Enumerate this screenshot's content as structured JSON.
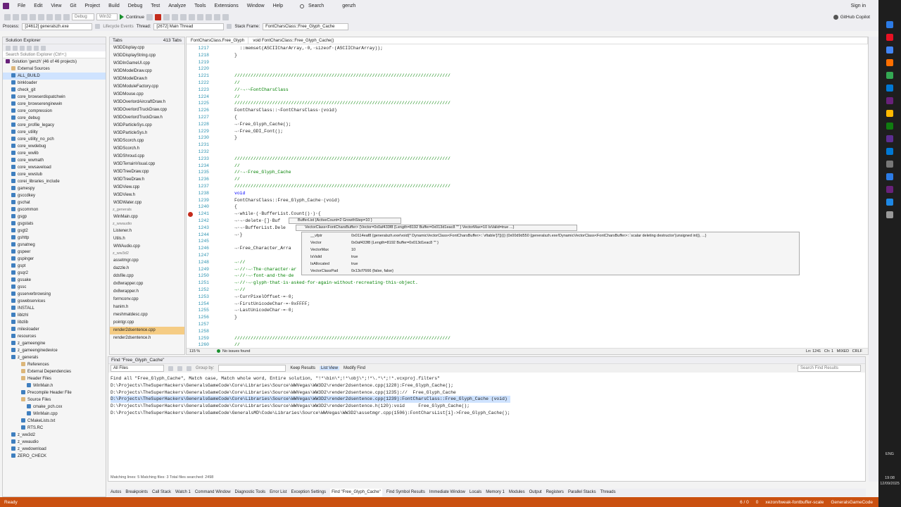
{
  "menu": [
    "File",
    "Edit",
    "View",
    "Git",
    "Project",
    "Build",
    "Debug",
    "Test",
    "Analyze",
    "Tools",
    "Extensions",
    "Window",
    "Help"
  ],
  "search_label": "Search",
  "solution_name": "genzh",
  "sign_in": "Sign in",
  "copilot": "GitHub Copilot",
  "toolbar": {
    "config": "Debug",
    "platform": "Win32",
    "continue": "Continue"
  },
  "procbar": {
    "process_label": "Process:",
    "process": "[24612] generalszh.exe",
    "lifecycle": "Lifecycle Events",
    "thread_label": "Thread:",
    "thread": "[2672] Main Thread",
    "frame_label": "Stack Frame:",
    "frame": "FontCharsClass::Free_Glyph_Cache"
  },
  "solution_explorer": {
    "title": "Solution Explorer",
    "search": "Search Solution Explorer (Ctrl+;)",
    "items": [
      "Solution 'genzh' (46 of 46 projects)",
      "External Sources",
      "ALL_BUILD",
      "binkloader",
      "check_git",
      "core_browserdispatchwin",
      "core_browserenginewin",
      "core_compression",
      "core_debug",
      "core_profile_legacy",
      "core_utility",
      "core_utility_no_pch",
      "core_wwdebug",
      "core_wwlib",
      "core_wwmath",
      "core_wwsaveload",
      "core_wwstub",
      "corei_libraries_include",
      "gamespy",
      "gsccdkey",
      "gschat",
      "gscommon",
      "gsgp",
      "gsgstats",
      "gsgt2",
      "gshttp",
      "gsnatneg",
      "gspeer",
      "gspinger",
      "gspt",
      "gsqr2",
      "gssake",
      "gssc",
      "gsserverbrowsing",
      "gswebservices",
      "INSTALL",
      "liblzhl",
      "libzlib",
      "milesloader",
      "resources",
      "z_gameengine",
      "z_gameenginedevice",
      "z_generals",
      "References",
      "External Dependencies",
      "Header Files",
      "WinMain.h",
      "Precompile Header File",
      "Source Files",
      "cmake_pch.cxx",
      "WinMain.cpp",
      "CMakeLists.txt",
      "RTS.RC",
      "z_ww3d2",
      "z_wwaudio",
      "z_wwdownload",
      "ZERO_CHECK"
    ]
  },
  "tabs_panel": {
    "title": "Tabs",
    "count": "413 Tabs",
    "groups": [
      {
        "name": "",
        "items": [
          "W3DDisplay.cpp",
          "W3DDisplayString.cpp",
          "W3DInGameUI.cpp",
          "W3DModelDraw.cpp",
          "W3DModelDraw.h",
          "W3DModuleFactory.cpp",
          "W3DMouse.cpp",
          "W3DOverlordAircraftDraw.h",
          "W3DOverlordTruckDraw.cpp",
          "W3DOverlordTruckDraw.h",
          "W3DParticleSys.cpp",
          "W3DParticleSys.h",
          "W3DScorch.cpp",
          "W3DScorch.h",
          "W3DShroud.cpp",
          "W3DTerrainVisual.cpp",
          "W3DTreeDraw.cpp",
          "W3DTreeDraw.h",
          "W3DView.cpp",
          "W3DView.h",
          "W3DWater.cpp"
        ]
      },
      {
        "name": "z_generals",
        "items": [
          "WinMain.cpp"
        ]
      },
      {
        "name": "z_wwaudio",
        "items": [
          "Listener.h",
          "Utils.h",
          "WWAudio.cpp"
        ]
      },
      {
        "name": "z_ww3d2",
        "items": [
          "assetmgr.cpp",
          "dazzle.h",
          "ddsfile.cpp",
          "dx8wrapper.cpp",
          "dx8wrapper.h",
          "formconv.cpp",
          "hanim.h",
          "meshmatdesc.cpp",
          "pointgr.cpp",
          "render2dsentence.cpp",
          "render2dsentence.h"
        ]
      }
    ]
  },
  "editor": {
    "file_tab": "FontCharsClass.Free_Glyph",
    "member": "void FontCharsClass::Free_Glyph_Cache()",
    "lines": [
      {
        "n": "1217",
        "t": "  ::memset(ASCIICharArray,·0,·sizeof·(ASCIICharArray));",
        "k": "c"
      },
      {
        "n": "1218",
        "t": "}",
        "k": "c"
      },
      {
        "n": "1219",
        "t": "",
        "k": "c"
      },
      {
        "n": "1220",
        "t": "",
        "k": "c"
      },
      {
        "n": "1221",
        "t": "////////////////////////////////////////////////////////////////////////////////",
        "k": "m"
      },
      {
        "n": "1222",
        "t": "//",
        "k": "m"
      },
      {
        "n": "1223",
        "t": "//·→·~FontCharsClass",
        "k": "m"
      },
      {
        "n": "1224",
        "t": "//",
        "k": "m"
      },
      {
        "n": "1225",
        "t": "////////////////////////////////////////////////////////////////////////////////",
        "k": "m"
      },
      {
        "n": "1226",
        "t": "FontCharsClass::~FontCharsClass·(void)",
        "k": "c"
      },
      {
        "n": "1227",
        "t": "{",
        "k": "c"
      },
      {
        "n": "1228",
        "t": "→·Free_Glyph_Cache();",
        "k": "c"
      },
      {
        "n": "1229",
        "t": "→·Free_GDI_Font();",
        "k": "c"
      },
      {
        "n": "1230",
        "t": "}",
        "k": "c"
      },
      {
        "n": "1231",
        "t": "",
        "k": "c"
      },
      {
        "n": "1232",
        "t": "",
        "k": "c"
      },
      {
        "n": "1233",
        "t": "////////////////////////////////////////////////////////////////////////////////",
        "k": "m"
      },
      {
        "n": "1234",
        "t": "//",
        "k": "m"
      },
      {
        "n": "1235",
        "t": "//·→·Free_Glyph_Cache",
        "k": "m"
      },
      {
        "n": "1236",
        "t": "//",
        "k": "m"
      },
      {
        "n": "1237",
        "t": "////////////////////////////////////////////////////////////////////////////////",
        "k": "m"
      },
      {
        "n": "1238",
        "t": "void",
        "k": "k"
      },
      {
        "n": "1239",
        "t": "FontCharsClass::Free_Glyph_Cache·(void)",
        "k": "c"
      },
      {
        "n": "1240",
        "t": "{",
        "k": "c"
      },
      {
        "n": "1241",
        "t": "→·while·(·BufferList.Count()·)·{",
        "k": "c"
      },
      {
        "n": "1242",
        "t": "→·→·delete·[]·Buf",
        "k": "c"
      },
      {
        "n": "1243",
        "t": "→·→·BufferList.Dele",
        "k": "c"
      },
      {
        "n": "1244",
        "t": "→·}",
        "k": "c"
      },
      {
        "n": "1245",
        "t": "",
        "k": "c"
      },
      {
        "n": "1246",
        "t": "→·Free_Character_Arra",
        "k": "c"
      },
      {
        "n": "1247",
        "t": "",
        "k": "c"
      },
      {
        "n": "1248",
        "t": "→·//",
        "k": "m"
      },
      {
        "n": "1249",
        "t": "→·//·→·The·character·ar",
        "k": "m"
      },
      {
        "n": "1250",
        "t": "→·//·→·font·and·the·de",
        "k": "m"
      },
      {
        "n": "1251",
        "t": "→·//·→·glyph·that·is·asked·for·again·without·recreating·this·object.",
        "k": "m"
      },
      {
        "n": "1252",
        "t": "→·//",
        "k": "m"
      },
      {
        "n": "1253",
        "t": "→·CurrPixelOffset·=·0;",
        "k": "c"
      },
      {
        "n": "1254",
        "t": "→·FirstUnicodeChar·=·0xFFFF;",
        "k": "c"
      },
      {
        "n": "1255",
        "t": "→·LastUnicodeChar·=·0;",
        "k": "c"
      },
      {
        "n": "1256",
        "t": "}",
        "k": "c"
      },
      {
        "n": "1257",
        "t": "",
        "k": "c"
      },
      {
        "n": "1258",
        "t": "",
        "k": "c"
      },
      {
        "n": "1259",
        "t": "////////////////////////////////////////////////////////////////////////////////",
        "k": "m"
      },
      {
        "n": "1260",
        "t": "//",
        "k": "m"
      }
    ],
    "zoom": "115 %",
    "issues": "No issues found",
    "position": "Ln: 1241   Ch: 1   MIXED   CRLF"
  },
  "datatip": {
    "root": "BufferList {ActiveCount=2 GrowthStep=10 }",
    "vector": "VectorClass<FontCharsBuffer> {Vector=0x0af433f8 {Length=8192 Buffer=0x013d1eac8 \"\" } VectorMax=10 IsValid=true ...}",
    "rows": [
      {
        "name": "__vfptr",
        "value": "0x0114eaf8 {generalszh.exe!void(* DynamicVectorClass<FontCharsBuffer>::`vftable'[7])()} {0x00d9d550 {generalszh.exe!DynamicVectorClass<FontCharsBuffer>::`scalar deleting destructor'(unsigned int)}, ...}"
      },
      {
        "name": "Vector",
        "value": "0x0af433f8 {Length=8192 Buffer=0x013d1eac8 \"\" }"
      },
      {
        "name": "VectorMax",
        "value": "10"
      },
      {
        "name": "IsValid",
        "value": "true"
      },
      {
        "name": "IsAllocated",
        "value": "true"
      },
      {
        "name": "VectorClassPad",
        "value": "0x13cf7666 {false, false}"
      }
    ]
  },
  "find": {
    "title": "Find \"Free_Glyph_Cache\"",
    "scope": "All Files",
    "group_by": "Group by:",
    "keep": "Keep Results",
    "list": "List View",
    "modify": "Modify Find",
    "search": "Search Find Results",
    "lines": [
      "Find all \"Free_Glyph_Cache\", Match case, Match whole word, Entire solution, \"!*\\bin\\*;!*\\obj\\*;!*\\.*\\*;!*.vcxproj.filters\"",
      "D:\\Projects\\TheSuperHackers\\GeneralsGameCode\\Core\\Libraries\\Source\\WWVegas\\WW3D2\\render2dsentence.cpp(1228):Free_Glyph_Cache();",
      "D:\\Projects\\TheSuperHackers\\GeneralsGameCode\\Core\\Libraries\\Source\\WWVegas\\WW3D2\\render2dsentence.cpp(1235)://  Free_Glyph_Cache",
      "D:\\Projects\\TheSuperHackers\\GeneralsGameCode\\Core\\Libraries\\Source\\WWVegas\\WW3D2\\render2dsentence.cpp(1239):FontCharsClass::Free_Glyph_Cache (void)",
      "D:\\Projects\\TheSuperHackers\\GeneralsGameCode\\Core\\Libraries\\Source\\WWVegas\\WW3D2\\render2dsentence.h(120):void     Free_Glyph_Cache();",
      "D:\\Projects\\TheSuperHackers\\GeneralsGameCode\\GeneralsMD\\Code\\Libraries\\Source\\WWVegas\\WW3D2\\assetmgr.cpp(1506):FontCharsList[i]->Free_Glyph_Cache();"
    ],
    "footer": "Matching lines: 5 Matching files: 3 Total files searched: 2498"
  },
  "bottom_tabs": [
    "Autos",
    "Breakpoints",
    "Call Stack",
    "Watch 1",
    "Command Window",
    "Diagnostic Tools",
    "Error List",
    "Exception Settings",
    "Find \"Free_Glyph_Cache\"",
    "Find Symbol Results",
    "Immediate Window",
    "Locals",
    "Memory 1",
    "Modules",
    "Output",
    "Registers",
    "Parallel Stacks",
    "Threads"
  ],
  "status": {
    "ready": "Ready",
    "arrows": "6 / 0",
    "pencil": "0",
    "branch": "xezon/tweak-fontbuffer-scale",
    "repo": "GeneralsGameCode"
  },
  "clock": {
    "time": "19:08",
    "date": "12/09/2025",
    "lang": "ENG"
  },
  "colors": {
    "status": "#ca5010",
    "find_highlight": "#cfe3ff",
    "selected_tab": "#f5cc84"
  }
}
